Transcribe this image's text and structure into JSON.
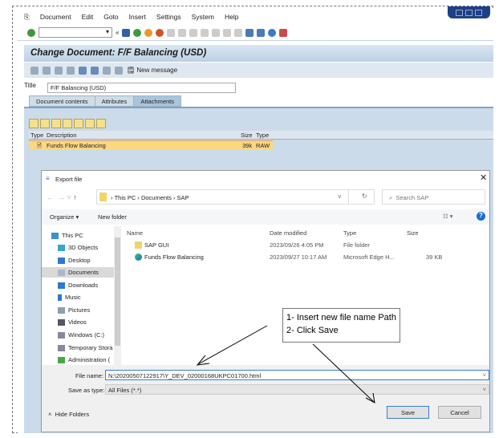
{
  "menu": [
    "Document",
    "Edit",
    "Goto",
    "Insert",
    "Settings",
    "System",
    "Help"
  ],
  "header": {
    "title": "Change Document: F/F Balancing (USD)"
  },
  "app_toolbar": {
    "new_message": "New message"
  },
  "title_label": "Title",
  "title_value": "F/F Balancing (USD)",
  "tabs": [
    "Document contents",
    "Attributes",
    "Attachments"
  ],
  "attachments": {
    "headers": [
      "Type",
      "Description",
      "Size",
      "Type"
    ],
    "rows": [
      {
        "description": "Funds Flow Balancing",
        "size": "39k",
        "type": "RAW"
      }
    ]
  },
  "dialog": {
    "title": "Export file",
    "breadcrumb": [
      "This PC",
      "Documents",
      "SAP"
    ],
    "search_placeholder": "Search SAP",
    "organize": "Organize ▾",
    "new_folder": "New folder",
    "nav": [
      "This PC",
      "3D Objects",
      "Desktop",
      "Documents",
      "Downloads",
      "Music",
      "Pictures",
      "Videos",
      "Windows (C:)",
      "Temporary Stora",
      "Administration ("
    ],
    "columns": [
      "Name",
      "Date modified",
      "Type",
      "Size"
    ],
    "files": [
      {
        "name": "SAP GUI",
        "date": "2023/09/26 4:05 PM",
        "type": "File folder",
        "size": ""
      },
      {
        "name": "Funds Flow Balancing",
        "date": "2023/09/27 10:17 AM",
        "type": "Microsoft Edge H...",
        "size": "39 KB"
      }
    ],
    "file_name_label": "File name:",
    "file_name": "N:\\20200507122917\\Y_DEV_02000168UKPC01700.html",
    "save_type_label": "Save as type:",
    "save_type": "All Files (*.*)",
    "hide_folders": "Hide Folders",
    "save": "Save",
    "cancel": "Cancel"
  },
  "callout": {
    "line1": "1-  Insert new file name Path",
    "line2": "2-  Click Save"
  }
}
